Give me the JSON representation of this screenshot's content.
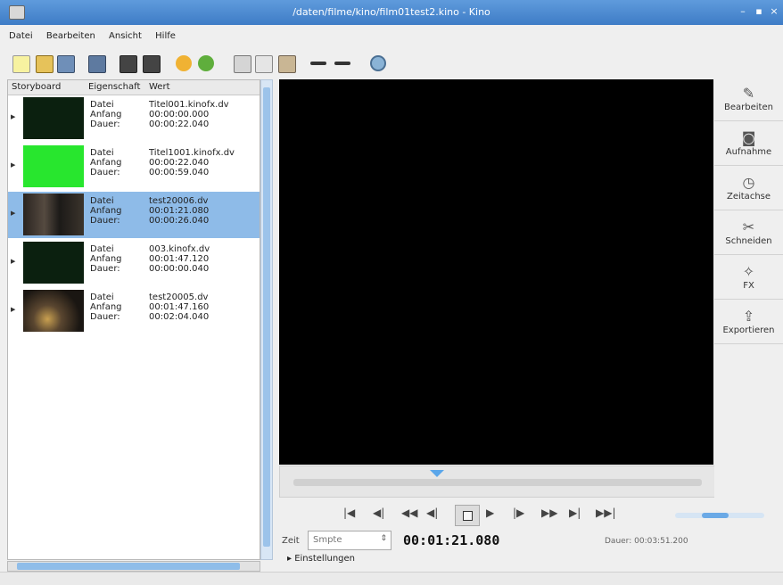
{
  "window": {
    "title": "/daten/filme/kino/film01test2.kino - Kino",
    "minimize": "–",
    "maximize": "▪",
    "close": "×"
  },
  "menu": [
    "Datei",
    "Bearbeiten",
    "Ansicht",
    "Hilfe"
  ],
  "toolbar": [
    "new-file-icon",
    "open-folder-icon",
    "save-icon",
    "save-as-icon",
    "insert-before-icon",
    "insert-after-icon",
    "undo-icon",
    "redo-icon",
    "cut-icon",
    "copy-icon",
    "paste-icon",
    "split-scene-icon",
    "join-scenes-icon",
    "zoom-icon"
  ],
  "storyboard": {
    "headers": [
      "Storyboard",
      "Eigenschaft",
      "Wert"
    ],
    "rows": [
      {
        "labels": [
          "Datei",
          "Anfang",
          "Dauer:"
        ],
        "values": [
          "Titel001.kinofx.dv",
          "00:00:00.000",
          "00:00:22.040"
        ],
        "thumb": "#0b200f",
        "selected": false
      },
      {
        "labels": [
          "Datei",
          "Anfang",
          "Dauer:"
        ],
        "values": [
          "Titel1001.kinofx.dv",
          "00:00:22.040",
          "00:00:59.040"
        ],
        "thumb": "#28e62e",
        "selected": false
      },
      {
        "labels": [
          "Datei",
          "Anfang",
          "Dauer:"
        ],
        "values": [
          "test20006.dv",
          "00:01:21.080",
          "00:00:26.040"
        ],
        "thumb": "scene",
        "selected": true
      },
      {
        "labels": [
          "Datei",
          "Anfang",
          "Dauer:"
        ],
        "values": [
          "003.kinofx.dv",
          "00:01:47.120",
          "00:00:00.040"
        ],
        "thumb": "#0b200f",
        "selected": false
      },
      {
        "labels": [
          "Datei",
          "Anfang",
          "Dauer:"
        ],
        "values": [
          "test20005.dv",
          "00:01:47.160",
          "00:02:04.040"
        ],
        "thumb": "scene2",
        "selected": false
      }
    ]
  },
  "sidebar": [
    {
      "label": "Bearbeiten",
      "icon": "edit-icon",
      "glyph": "✎"
    },
    {
      "label": "Aufnahme",
      "icon": "capture-icon",
      "glyph": "◙"
    },
    {
      "label": "Zeitachse",
      "icon": "timeline-icon",
      "glyph": "◷"
    },
    {
      "label": "Schneiden",
      "icon": "trim-icon",
      "glyph": "✂"
    },
    {
      "label": "FX",
      "icon": "fx-icon",
      "glyph": "✧"
    },
    {
      "label": "Exportieren",
      "icon": "export-icon",
      "glyph": "⇪"
    }
  ],
  "transport": [
    {
      "name": "start-icon",
      "glyph": "|◀"
    },
    {
      "name": "prev-scene-icon",
      "glyph": "◀|"
    },
    {
      "name": "rewind-icon",
      "glyph": "◀◀"
    },
    {
      "name": "back-frame-icon",
      "glyph": "◀|"
    },
    {
      "name": "play-icon",
      "glyph": "▶"
    },
    {
      "name": "forward-frame-icon",
      "glyph": "|▶"
    },
    {
      "name": "fast-forward-icon",
      "glyph": "▶▶"
    },
    {
      "name": "next-scene-icon",
      "glyph": "▶|"
    },
    {
      "name": "end-icon",
      "glyph": "▶▶|"
    }
  ],
  "playback_speed": 0.6,
  "time": {
    "label": "Zeit",
    "mode": "Smpte",
    "timecode": "00:01:21.080",
    "duration": "Dauer: 00:03:51.200"
  },
  "settings_label": "Einstellungen",
  "colors": {
    "titlebar": "#4a8ad4",
    "selection": "#8ebbe8",
    "accent": "#5aa6ea"
  }
}
